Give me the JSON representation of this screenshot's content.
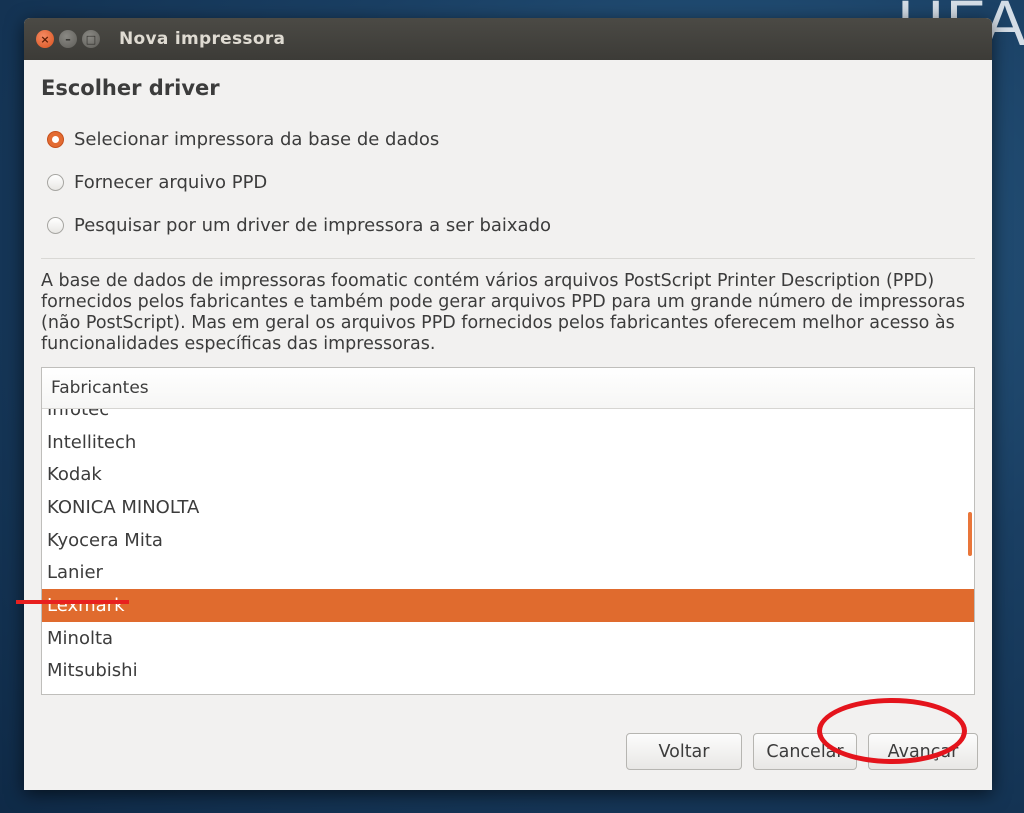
{
  "background": {
    "text": "UFA"
  },
  "window": {
    "title": "Nova impressora",
    "controls": [
      "close-icon",
      "minimize-icon",
      "maximize-icon"
    ]
  },
  "section_title": "Escolher driver",
  "options": [
    {
      "label": "Selecionar impressora da base de dados",
      "checked": true
    },
    {
      "label": "Fornecer arquivo PPD",
      "checked": false
    },
    {
      "label": "Pesquisar por um driver de impressora a ser baixado",
      "checked": false
    }
  ],
  "description": "A base de dados de impressoras foomatic contém vários arquivos PostScript Printer Description (PPD) fornecidos pelos fabricantes e também pode gerar arquivos PPD para um grande número de impressoras (não PostScript). Mas em geral os arquivos PPD fornecidos pelos fabricantes oferecem melhor acesso às funcionalidades específicas das impressoras.",
  "manufacturers": {
    "header": "Fabricantes",
    "items": [
      "Infotec",
      "Intellitech",
      "Kodak",
      "KONICA MINOLTA",
      "Kyocera Mita",
      "Lanier",
      "Lexmark",
      "Minolta",
      "Mitsubishi"
    ],
    "selected": "Lexmark"
  },
  "buttons": {
    "back": "Voltar",
    "cancel": "Cancelar",
    "next": "Avançar"
  },
  "colors": {
    "accent": "#e06b2e",
    "annotation": "#e4141c",
    "titlebar": "#3c3b37"
  }
}
